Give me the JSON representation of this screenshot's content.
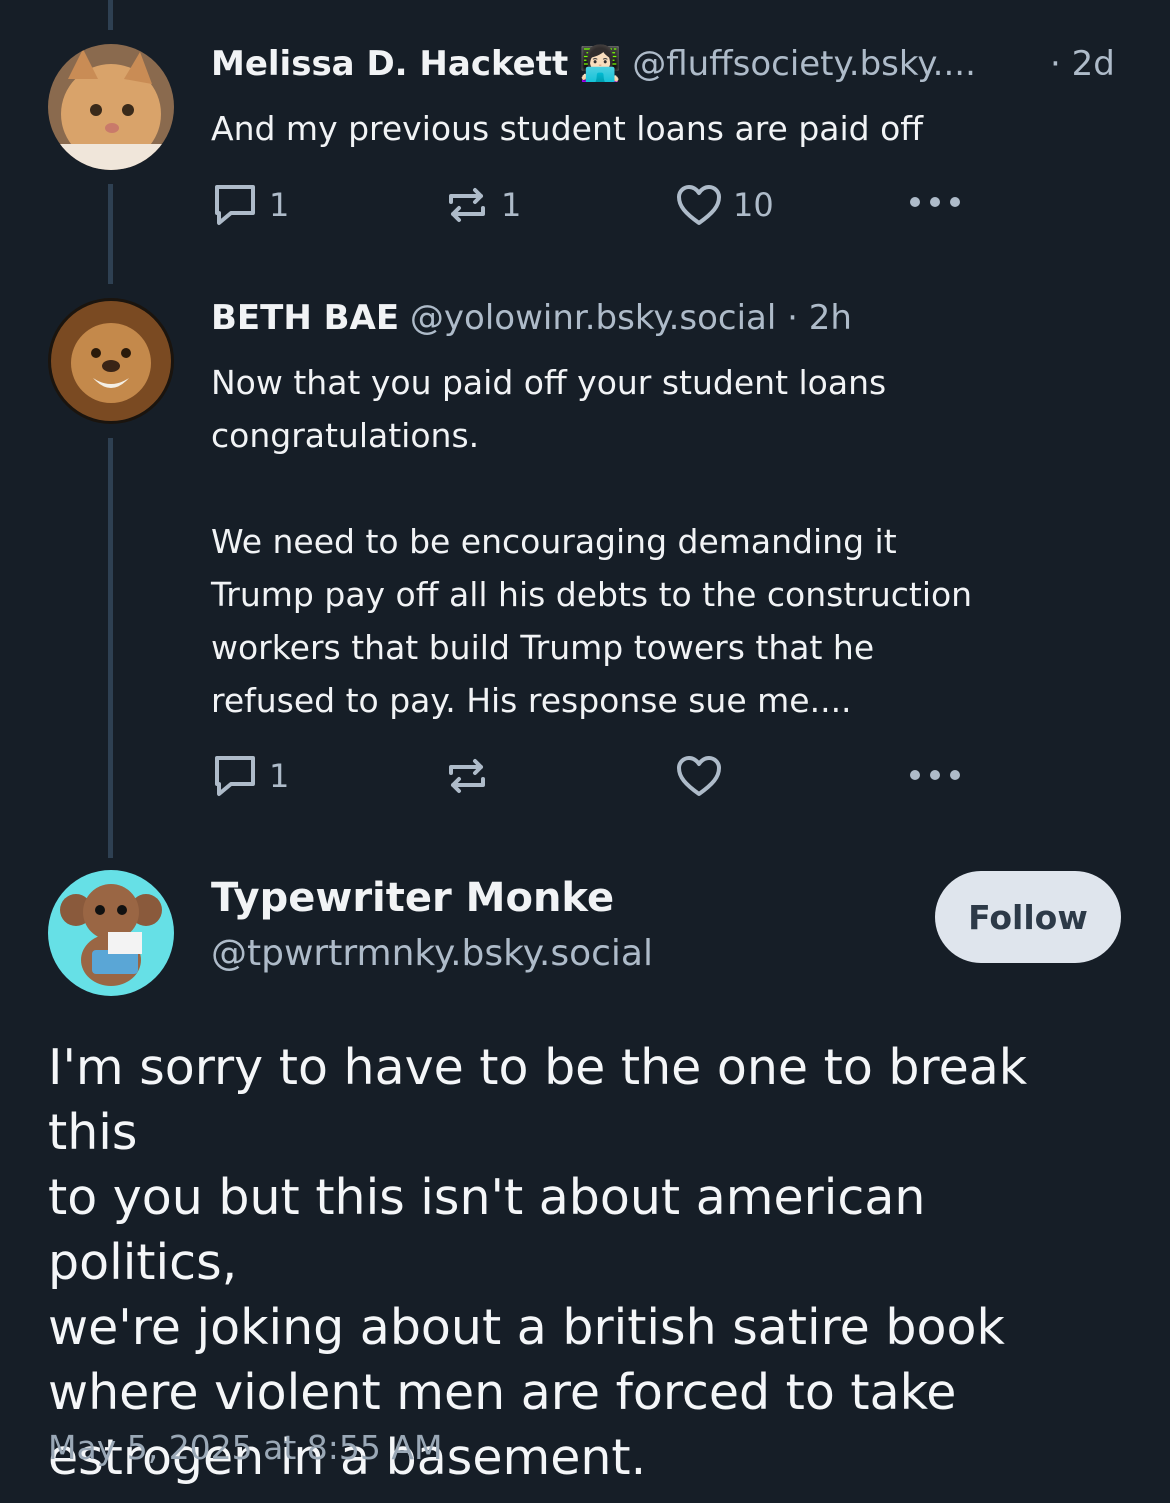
{
  "posts": [
    {
      "name": "Melissa D. Hackett",
      "badge": "👩🏻‍💻",
      "handle": "@fluffsociety.bsky....",
      "time": "· 2d",
      "text": "And my previous student loans are paid off",
      "replies": "1",
      "reposts": "1",
      "likes": "10"
    },
    {
      "name": "BETH BAE",
      "handle": "@yolowinr.bsky.social",
      "time": "· 2h",
      "text_lines": [
        "Now that you paid off your student loans",
        "congratulations.",
        "",
        "We need to be encouraging demanding it",
        "Trump pay off all his debts to the construction",
        "workers that build Trump towers that he",
        "refused to pay. His response sue me...."
      ],
      "replies": "1",
      "reposts": "",
      "likes": ""
    }
  ],
  "main_post": {
    "name": "Typewriter Monke",
    "handle": "@tpwrtrmnky.bsky.social",
    "follow_label": "Follow",
    "text_lines": [
      "I'm sorry to have to be the one to break this",
      "to you but this isn't about american politics,",
      "we're joking about a british satire book",
      "where violent men are forced to take",
      "estrogen in a basement."
    ],
    "timestamp": "May 5, 2025 at 8:55 AM"
  },
  "colors": {
    "background": "#161e27",
    "thread_line": "#2e4052",
    "secondary_text": "#aebbc9",
    "follow_button": "#dfe5ed"
  }
}
